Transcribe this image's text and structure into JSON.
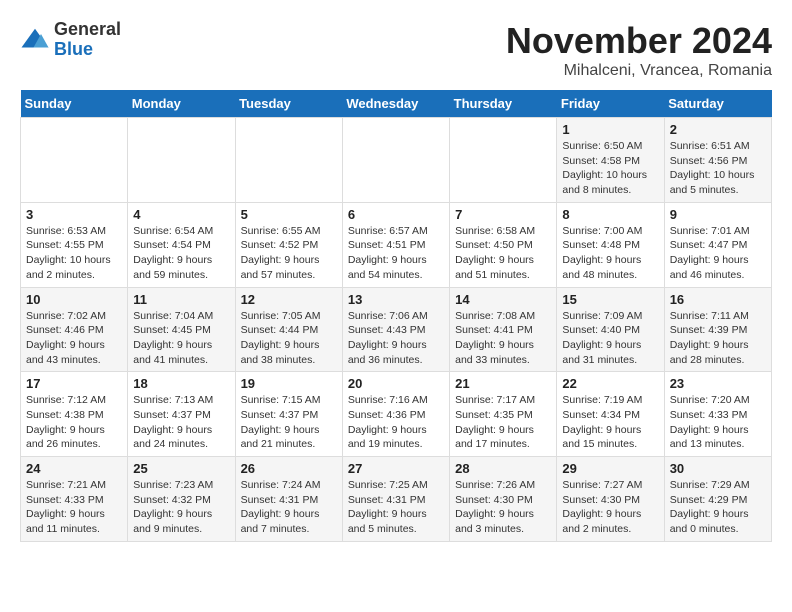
{
  "logo": {
    "general": "General",
    "blue": "Blue"
  },
  "header": {
    "month": "November 2024",
    "location": "Mihalceni, Vrancea, Romania"
  },
  "weekdays": [
    "Sunday",
    "Monday",
    "Tuesday",
    "Wednesday",
    "Thursday",
    "Friday",
    "Saturday"
  ],
  "weeks": [
    [
      {
        "day": "",
        "info": ""
      },
      {
        "day": "",
        "info": ""
      },
      {
        "day": "",
        "info": ""
      },
      {
        "day": "",
        "info": ""
      },
      {
        "day": "",
        "info": ""
      },
      {
        "day": "1",
        "info": "Sunrise: 6:50 AM\nSunset: 4:58 PM\nDaylight: 10 hours and 8 minutes."
      },
      {
        "day": "2",
        "info": "Sunrise: 6:51 AM\nSunset: 4:56 PM\nDaylight: 10 hours and 5 minutes."
      }
    ],
    [
      {
        "day": "3",
        "info": "Sunrise: 6:53 AM\nSunset: 4:55 PM\nDaylight: 10 hours and 2 minutes."
      },
      {
        "day": "4",
        "info": "Sunrise: 6:54 AM\nSunset: 4:54 PM\nDaylight: 9 hours and 59 minutes."
      },
      {
        "day": "5",
        "info": "Sunrise: 6:55 AM\nSunset: 4:52 PM\nDaylight: 9 hours and 57 minutes."
      },
      {
        "day": "6",
        "info": "Sunrise: 6:57 AM\nSunset: 4:51 PM\nDaylight: 9 hours and 54 minutes."
      },
      {
        "day": "7",
        "info": "Sunrise: 6:58 AM\nSunset: 4:50 PM\nDaylight: 9 hours and 51 minutes."
      },
      {
        "day": "8",
        "info": "Sunrise: 7:00 AM\nSunset: 4:48 PM\nDaylight: 9 hours and 48 minutes."
      },
      {
        "day": "9",
        "info": "Sunrise: 7:01 AM\nSunset: 4:47 PM\nDaylight: 9 hours and 46 minutes."
      }
    ],
    [
      {
        "day": "10",
        "info": "Sunrise: 7:02 AM\nSunset: 4:46 PM\nDaylight: 9 hours and 43 minutes."
      },
      {
        "day": "11",
        "info": "Sunrise: 7:04 AM\nSunset: 4:45 PM\nDaylight: 9 hours and 41 minutes."
      },
      {
        "day": "12",
        "info": "Sunrise: 7:05 AM\nSunset: 4:44 PM\nDaylight: 9 hours and 38 minutes."
      },
      {
        "day": "13",
        "info": "Sunrise: 7:06 AM\nSunset: 4:43 PM\nDaylight: 9 hours and 36 minutes."
      },
      {
        "day": "14",
        "info": "Sunrise: 7:08 AM\nSunset: 4:41 PM\nDaylight: 9 hours and 33 minutes."
      },
      {
        "day": "15",
        "info": "Sunrise: 7:09 AM\nSunset: 4:40 PM\nDaylight: 9 hours and 31 minutes."
      },
      {
        "day": "16",
        "info": "Sunrise: 7:11 AM\nSunset: 4:39 PM\nDaylight: 9 hours and 28 minutes."
      }
    ],
    [
      {
        "day": "17",
        "info": "Sunrise: 7:12 AM\nSunset: 4:38 PM\nDaylight: 9 hours and 26 minutes."
      },
      {
        "day": "18",
        "info": "Sunrise: 7:13 AM\nSunset: 4:37 PM\nDaylight: 9 hours and 24 minutes."
      },
      {
        "day": "19",
        "info": "Sunrise: 7:15 AM\nSunset: 4:37 PM\nDaylight: 9 hours and 21 minutes."
      },
      {
        "day": "20",
        "info": "Sunrise: 7:16 AM\nSunset: 4:36 PM\nDaylight: 9 hours and 19 minutes."
      },
      {
        "day": "21",
        "info": "Sunrise: 7:17 AM\nSunset: 4:35 PM\nDaylight: 9 hours and 17 minutes."
      },
      {
        "day": "22",
        "info": "Sunrise: 7:19 AM\nSunset: 4:34 PM\nDaylight: 9 hours and 15 minutes."
      },
      {
        "day": "23",
        "info": "Sunrise: 7:20 AM\nSunset: 4:33 PM\nDaylight: 9 hours and 13 minutes."
      }
    ],
    [
      {
        "day": "24",
        "info": "Sunrise: 7:21 AM\nSunset: 4:33 PM\nDaylight: 9 hours and 11 minutes."
      },
      {
        "day": "25",
        "info": "Sunrise: 7:23 AM\nSunset: 4:32 PM\nDaylight: 9 hours and 9 minutes."
      },
      {
        "day": "26",
        "info": "Sunrise: 7:24 AM\nSunset: 4:31 PM\nDaylight: 9 hours and 7 minutes."
      },
      {
        "day": "27",
        "info": "Sunrise: 7:25 AM\nSunset: 4:31 PM\nDaylight: 9 hours and 5 minutes."
      },
      {
        "day": "28",
        "info": "Sunrise: 7:26 AM\nSunset: 4:30 PM\nDaylight: 9 hours and 3 minutes."
      },
      {
        "day": "29",
        "info": "Sunrise: 7:27 AM\nSunset: 4:30 PM\nDaylight: 9 hours and 2 minutes."
      },
      {
        "day": "30",
        "info": "Sunrise: 7:29 AM\nSunset: 4:29 PM\nDaylight: 9 hours and 0 minutes."
      }
    ]
  ]
}
